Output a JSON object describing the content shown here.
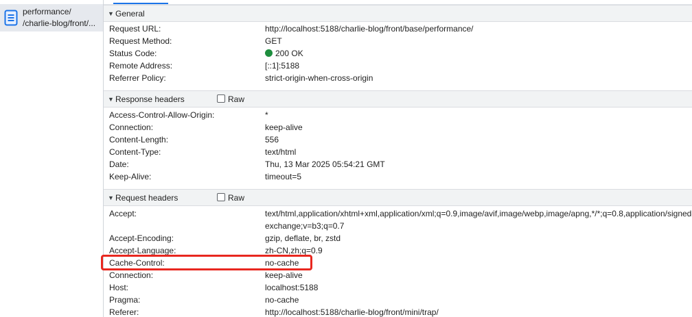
{
  "request_list": {
    "selected": {
      "name_line1": "performance/",
      "name_line2": "/charlie-blog/front/..."
    }
  },
  "general": {
    "title": "General",
    "rows": [
      {
        "key": "Request URL:",
        "value": "http://localhost:5188/charlie-blog/front/base/performance/"
      },
      {
        "key": "Request Method:",
        "value": "GET"
      },
      {
        "key": "Status Code:",
        "value": "200 OK"
      },
      {
        "key": "Remote Address:",
        "value": "[::1]:5188"
      },
      {
        "key": "Referrer Policy:",
        "value": "strict-origin-when-cross-origin"
      }
    ],
    "status_color": "#1e8e3e"
  },
  "response_headers": {
    "title": "Response headers",
    "raw_label": "Raw",
    "rows": [
      {
        "key": "Access-Control-Allow-Origin:",
        "value": "*"
      },
      {
        "key": "Connection:",
        "value": "keep-alive"
      },
      {
        "key": "Content-Length:",
        "value": "556"
      },
      {
        "key": "Content-Type:",
        "value": "text/html"
      },
      {
        "key": "Date:",
        "value": "Thu, 13 Mar 2025 05:54:21 GMT"
      },
      {
        "key": "Keep-Alive:",
        "value": "timeout=5"
      }
    ]
  },
  "request_headers": {
    "title": "Request headers",
    "raw_label": "Raw",
    "accept": {
      "key": "Accept:",
      "value_line1": "text/html,application/xhtml+xml,application/xml;q=0.9,image/avif,image/webp,image/apng,*/*;q=0.8,application/signed-",
      "value_line2": "exchange;v=b3;q=0.7"
    },
    "rows": [
      {
        "key": "Accept-Encoding:",
        "value": "gzip, deflate, br, zstd"
      },
      {
        "key": "Accept-Language:",
        "value": "zh-CN,zh;q=0.9"
      },
      {
        "key": "Cache-Control:",
        "value": "no-cache"
      },
      {
        "key": "Connection:",
        "value": "keep-alive"
      },
      {
        "key": "Host:",
        "value": "localhost:5188"
      },
      {
        "key": "Pragma:",
        "value": "no-cache"
      },
      {
        "key": "Referer:",
        "value": "http://localhost:5188/charlie-blog/front/mini/trap/"
      }
    ]
  },
  "colors": {
    "highlight": "#e8271f",
    "icon_blue": "#1a73e8"
  }
}
